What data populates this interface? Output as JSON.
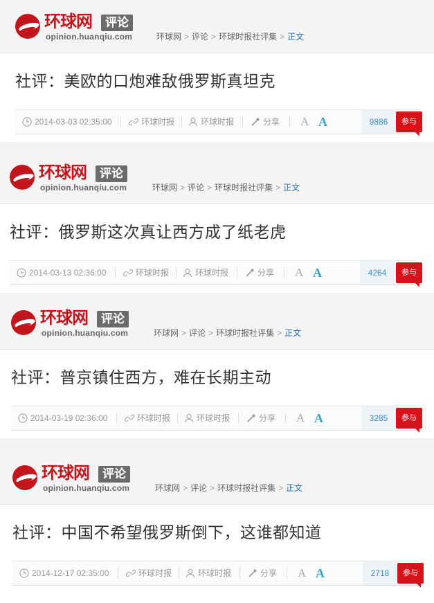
{
  "site": {
    "logo_text": "环球网",
    "logo_tag": "评论",
    "domain": "opinion.huanqiu.com",
    "breadcrumb": [
      "环球网",
      "评论",
      "环球时报社评集",
      "正文"
    ],
    "breadcrumb_sep": ">"
  },
  "meta_labels": {
    "source": "环球时报",
    "author": "环球时报",
    "share": "分享",
    "font_small": "A",
    "font_large": "A",
    "join": "参与"
  },
  "articles": [
    {
      "title": "社评：美欧的口炮难敌俄罗斯真坦克",
      "datetime": "2014-03-03 02:35:00",
      "count": "9886"
    },
    {
      "title": "社评：俄罗斯这次真让西方成了纸老虎",
      "datetime": "2014-03-13 02:36:00",
      "count": "4264"
    },
    {
      "title": "社评：普京镇住西方，难在长期主动",
      "datetime": "2014-03-19 02:36:00",
      "count": "3285"
    },
    {
      "title": "社评：中国不希望俄罗斯倒下，这谁都知道",
      "datetime": "2014-12-17 02:35:00",
      "count": "2718"
    }
  ],
  "colors": {
    "brand_red": "#c3161c",
    "link_blue": "#2a6fb5",
    "accent_cyan": "#36a3c7",
    "join_red": "#d7121b"
  },
  "icons": [
    "clock-icon",
    "link-icon",
    "user-icon",
    "share-icon"
  ]
}
